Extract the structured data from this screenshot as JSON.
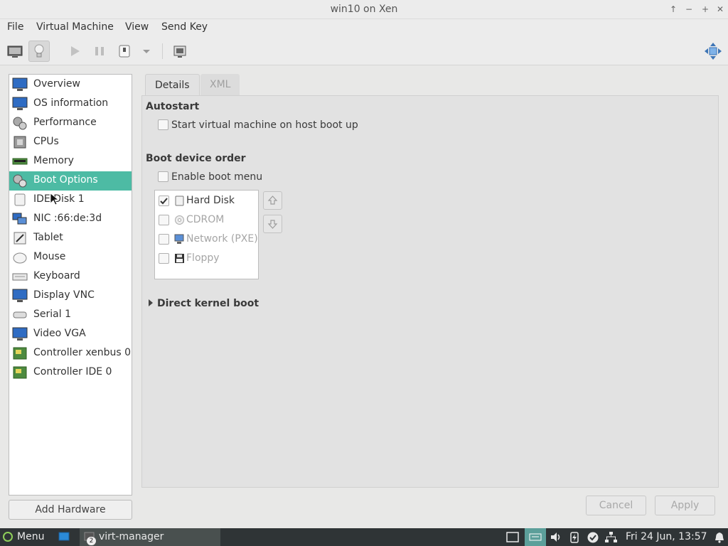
{
  "window": {
    "title": "win10 on Xen"
  },
  "menubar": [
    "File",
    "Virtual Machine",
    "View",
    "Send Key"
  ],
  "sidebar": {
    "items": [
      {
        "label": "Overview",
        "icon": "monitor-icon"
      },
      {
        "label": "OS information",
        "icon": "monitor-icon"
      },
      {
        "label": "Performance",
        "icon": "performance-gears-icon"
      },
      {
        "label": "CPUs",
        "icon": "cpu-chip-icon"
      },
      {
        "label": "Memory",
        "icon": "memory-module-icon"
      },
      {
        "label": "Boot Options",
        "icon": "gears-icon",
        "selected": true
      },
      {
        "label": "IDE Disk 1",
        "icon": "disk-icon"
      },
      {
        "label": "NIC :66:de:3d",
        "icon": "network-icon"
      },
      {
        "label": "Tablet",
        "icon": "tablet-icon"
      },
      {
        "label": "Mouse",
        "icon": "mouse-icon"
      },
      {
        "label": "Keyboard",
        "icon": "keyboard-icon"
      },
      {
        "label": "Display VNC",
        "icon": "monitor-icon"
      },
      {
        "label": "Serial 1",
        "icon": "serial-icon"
      },
      {
        "label": "Video VGA",
        "icon": "monitor-icon"
      },
      {
        "label": "Controller xenbus 0",
        "icon": "controller-card-icon"
      },
      {
        "label": "Controller IDE 0",
        "icon": "controller-card-icon"
      }
    ],
    "add_hardware": "Add Hardware"
  },
  "tabs": {
    "details": "Details",
    "xml": "XML"
  },
  "autostart": {
    "heading": "Autostart",
    "checkbox_label": "Start virtual machine on host boot up",
    "checked": false
  },
  "boot_order": {
    "heading": "Boot device order",
    "enable_menu_label": "Enable boot menu",
    "enable_menu_checked": false,
    "devices": [
      {
        "label": "Hard Disk",
        "checked": true,
        "icon": "hard-disk-icon"
      },
      {
        "label": "CDROM",
        "checked": false,
        "icon": "cdrom-icon"
      },
      {
        "label": "Network (PXE)",
        "checked": false,
        "icon": "network-icon"
      },
      {
        "label": "Floppy",
        "checked": false,
        "icon": "floppy-icon"
      }
    ]
  },
  "direct_kernel_boot": "Direct kernel boot",
  "buttons": {
    "cancel": "Cancel",
    "apply": "Apply"
  },
  "taskbar": {
    "menu": "Menu",
    "task": "virt-manager",
    "task_badge": "2",
    "clock": "Fri 24 Jun, 13:57"
  },
  "colors": {
    "accent": "#4dbba4",
    "taskbar": "#2f3436"
  }
}
